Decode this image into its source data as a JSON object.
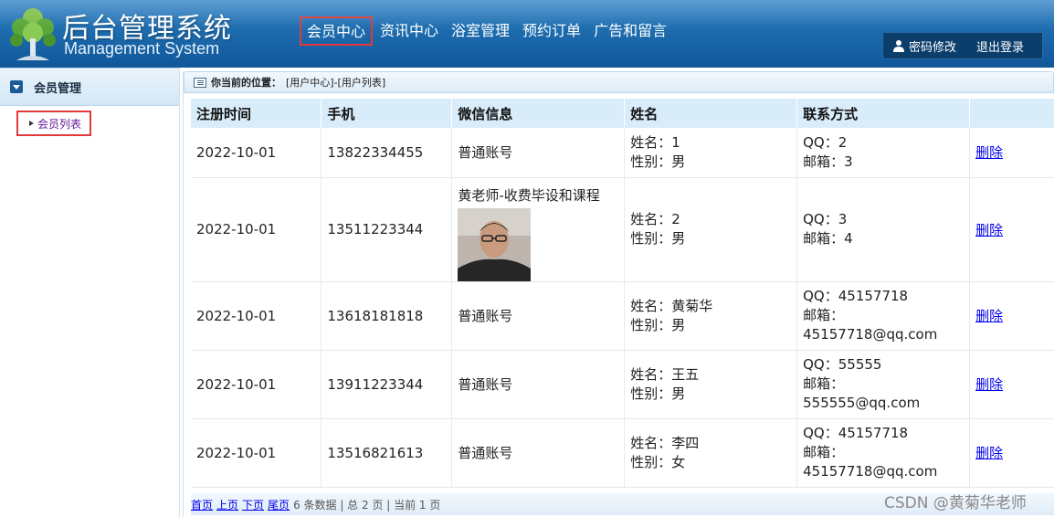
{
  "header": {
    "title": "后台管理系统",
    "subtitle": "Management System",
    "nav": [
      {
        "label": "会员中心",
        "active": true
      },
      {
        "label": "资讯中心",
        "active": false
      },
      {
        "label": "浴室管理",
        "active": false
      },
      {
        "label": "预约订单",
        "active": false
      },
      {
        "label": "广告和留言",
        "active": false
      }
    ],
    "user_links": {
      "change_password": "密码修改",
      "logout": "退出登录"
    }
  },
  "sidebar": {
    "group_label": "会员管理",
    "items": [
      {
        "label": "会员列表"
      }
    ]
  },
  "breadcrumb": {
    "label": "你当前的位置：",
    "path": "[用户中心]-[用户列表]"
  },
  "table": {
    "columns": [
      "注册时间",
      "手机",
      "微信信息",
      "姓名",
      "联系方式",
      ""
    ],
    "rows": [
      {
        "date": "2022-10-01",
        "phone": "13822334455",
        "wechat": "普通账号",
        "avatar": false,
        "name": "姓名：1",
        "gender": "性别：男",
        "qq": "QQ：2",
        "email_label": "邮箱：3",
        "email": "",
        "action": "删除"
      },
      {
        "date": "2022-10-01",
        "phone": "13511223344",
        "wechat": "黄老师-收费毕设和课程",
        "avatar": true,
        "name": "姓名：2",
        "gender": "性别：男",
        "qq": "QQ：3",
        "email_label": "邮箱：4",
        "email": "",
        "action": "删除"
      },
      {
        "date": "2022-10-01",
        "phone": "13618181818",
        "wechat": "普通账号",
        "avatar": false,
        "name": "姓名：黄菊华",
        "gender": "性别：男",
        "qq": "QQ：45157718",
        "email_label": "邮箱：",
        "email": "45157718@qq.com",
        "action": "删除"
      },
      {
        "date": "2022-10-01",
        "phone": "13911223344",
        "wechat": "普通账号",
        "avatar": false,
        "name": "姓名：王五",
        "gender": "性别：男",
        "qq": "QQ：55555",
        "email_label": "邮箱：",
        "email": "555555@qq.com",
        "action": "删除"
      },
      {
        "date": "2022-10-01",
        "phone": "13516821613",
        "wechat": "普通账号",
        "avatar": false,
        "name": "姓名：李四",
        "gender": "性别：女",
        "qq": "QQ：45157718",
        "email_label": "邮箱：",
        "email": "45157718@qq.com",
        "action": "删除"
      }
    ]
  },
  "pager": {
    "first": "首页",
    "prev": "上页",
    "next": "下页",
    "last": "尾页",
    "info": "6 条数据 | 总 2 页 | 当前 1 页"
  },
  "watermark": "CSDN @黄菊华老师",
  "colors": {
    "header": "#1d6cae",
    "active_outline": "#e03a3a",
    "table_header": "#d8ecf9",
    "link": "#0000ee"
  },
  "icons": [
    "logo-tree-icon",
    "user-icon",
    "collapse-arrow-icon",
    "list-arrow-icon",
    "breadcrumb-list-icon"
  ]
}
